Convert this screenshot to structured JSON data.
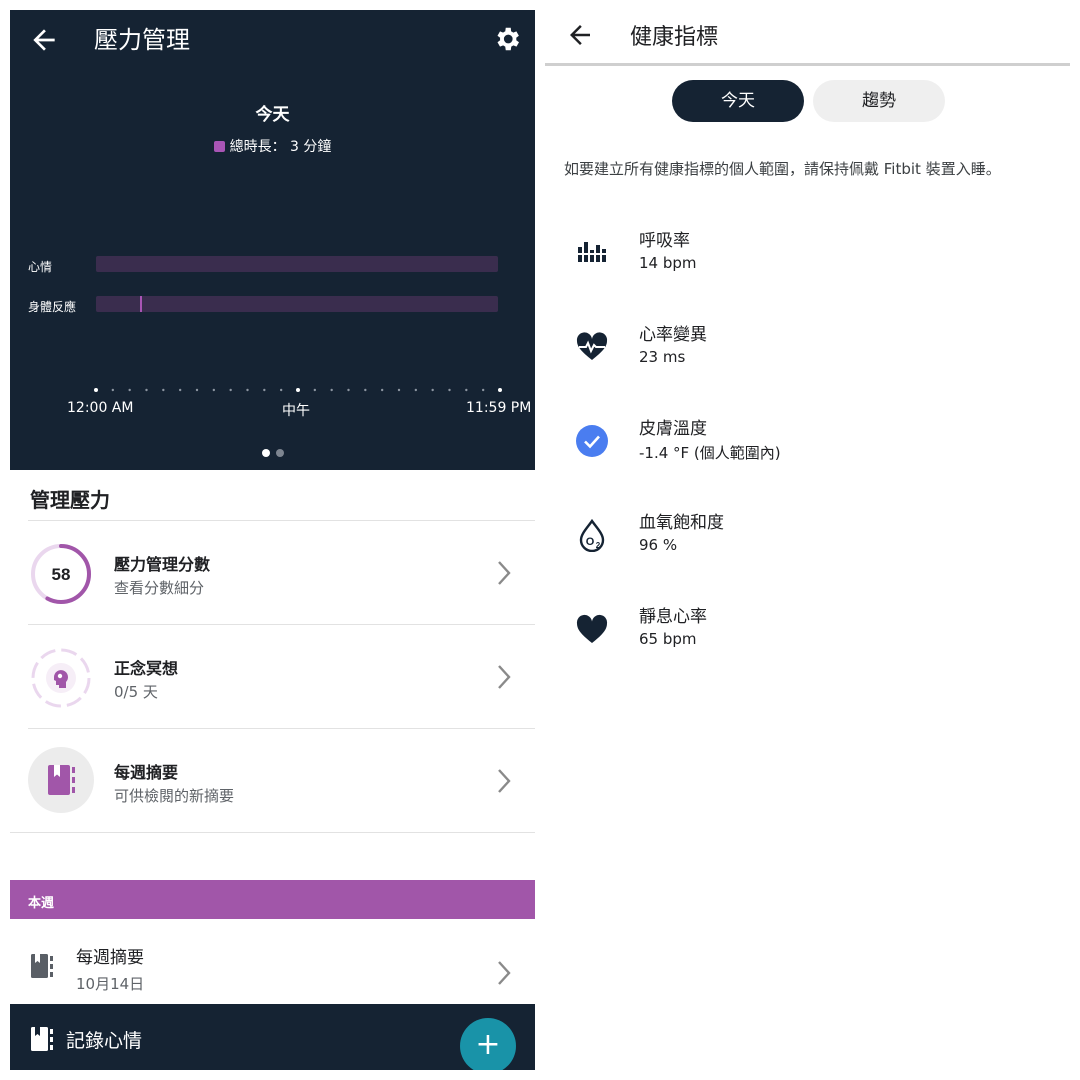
{
  "left": {
    "header": {
      "title": "壓力管理"
    },
    "chart": {
      "today_label": "今天",
      "legend": "總時長： 3 分鐘",
      "rows": [
        {
          "label": "心情"
        },
        {
          "label": "身體反應"
        }
      ],
      "axis": {
        "start": "12:00 AM",
        "mid": "中午",
        "end": "11:59 PM"
      }
    },
    "section_title": "管理壓力",
    "items": [
      {
        "title": "壓力管理分數",
        "subtitle": "查看分數細分",
        "badge": "58",
        "progress": 0.58
      },
      {
        "title": "正念冥想",
        "subtitle": "0/5 天"
      },
      {
        "title": "每週摘要",
        "subtitle": "可供檢閱的新摘要"
      }
    ],
    "this_week": {
      "label": "本週",
      "item": {
        "title": "每週摘要",
        "subtitle": "10月14日"
      }
    },
    "bottom": {
      "label": "記錄心情",
      "fab": "+"
    }
  },
  "right": {
    "header": {
      "title": "健康指標"
    },
    "tabs": [
      {
        "label": "今天",
        "selected": true
      },
      {
        "label": "趨勢",
        "selected": false
      }
    ],
    "note": "如要建立所有健康指標的個人範圍，請保持佩戴 Fitbit 裝置入睡。",
    "metrics": [
      {
        "name": "呼吸率",
        "value": "14 bpm",
        "icon": "breathing-rate-icon"
      },
      {
        "name": "心率變異",
        "value": "23 ms",
        "icon": "hrv-heart-icon"
      },
      {
        "name": "皮膚溫度",
        "value": "-1.4 °F (個人範圍內)",
        "icon": "check-circle-icon"
      },
      {
        "name": "血氧飽和度",
        "value": "96 %",
        "icon": "spo2-drop-icon"
      },
      {
        "name": "靜息心率",
        "value": "65 bpm",
        "icon": "heart-icon"
      }
    ]
  },
  "colors": {
    "header_navy": "#152333",
    "accent_purple": "#a156a9",
    "fab_teal": "#1993a8",
    "check_blue": "#4a7df0"
  }
}
